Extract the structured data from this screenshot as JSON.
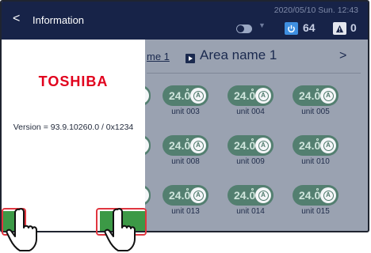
{
  "topbar": {
    "datetime": "2020/05/10 Sun. 12:43",
    "power_count": "64",
    "alarm_count": "0",
    "icons": [
      "toggle-icon",
      "chevron-down-icon",
      "power-icon",
      "warning-icon"
    ]
  },
  "content": {
    "breadcrumb": "me 1",
    "area_title": "Area name 1",
    "next_glyph": ">",
    "rows": [
      [
        {
          "temp": "24.0",
          "mode": "A",
          "name": "unit 003"
        },
        {
          "temp": "24.0",
          "mode": "A",
          "name": "unit 004"
        },
        {
          "temp": "24.0",
          "mode": "A",
          "name": "unit 005"
        }
      ],
      [
        {
          "temp": "24.0",
          "mode": "A",
          "name": "unit 008"
        },
        {
          "temp": "24.0",
          "mode": "A",
          "name": "unit 009"
        },
        {
          "temp": "24.0",
          "mode": "A",
          "name": "unit 010"
        }
      ],
      [
        {
          "temp": "24.0",
          "mode": "A",
          "name": "unit 013"
        },
        {
          "temp": "24.0",
          "mode": "A",
          "name": "unit 014"
        },
        {
          "temp": "24.0",
          "mode": "A",
          "name": "unit 015"
        }
      ]
    ]
  },
  "panel": {
    "back_glyph": "<",
    "title": "Information",
    "logo": "TOSHIBA",
    "version": "Version = 93.9.10260.0 / 0x1234"
  },
  "colors": {
    "topbar": "#172348",
    "unit_pill": "#537f70",
    "logo_red": "#e1001d",
    "action_green": "#3c9946",
    "highlight_red": "#e0363f"
  }
}
